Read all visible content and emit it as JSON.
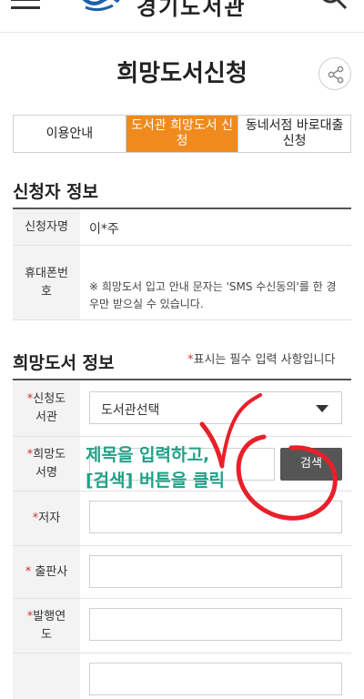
{
  "header": {
    "site_title": "경기도서관",
    "icons": {
      "menu": "menu-icon",
      "logo": "library-logo",
      "search": "search-icon"
    }
  },
  "page": {
    "title": "희망도서신청",
    "share_icon": "share-icon"
  },
  "tabs": [
    {
      "label": "이용안내",
      "active": false
    },
    {
      "label": "도서관 희망도서 신청",
      "active": true
    },
    {
      "label": "동네서점 바로대출신청",
      "active": false
    }
  ],
  "applicant": {
    "section_title": "신청자 정보",
    "name_label": "신청자명",
    "name_value": "이*주",
    "phone_label": "휴대폰번호",
    "notice": "※ 희망도서 입고 안내 문자는 'SMS 수신동의'를 한 경우만 받으실 수 있습니다."
  },
  "book": {
    "section_title": "희망도서 정보",
    "required_note_star": "*",
    "required_note": "표시는 필수 입력 사항입니다",
    "fields": {
      "library": {
        "star": "*",
        "label": "신청도서관",
        "value": "도서관선택"
      },
      "title": {
        "star": "*",
        "label": "희망도서명",
        "value": ""
      },
      "author": {
        "star": "*",
        "label": "저자",
        "value": ""
      },
      "publisher": {
        "star": "*",
        "label": "출판사",
        "value": ""
      },
      "year": {
        "star": "*",
        "label": "발행연도",
        "value": ""
      },
      "isbn": {
        "label": "",
        "value": ""
      }
    },
    "search_label": "검색"
  },
  "annotation": {
    "line1": "제목을 입력하고,",
    "line2": "[검색] 버튼을 클릭",
    "color": "#1fa187",
    "mark_color": "#e8202a"
  },
  "colors": {
    "accent": "#f08a1c",
    "required": "#d3332a",
    "button": "#555555"
  }
}
